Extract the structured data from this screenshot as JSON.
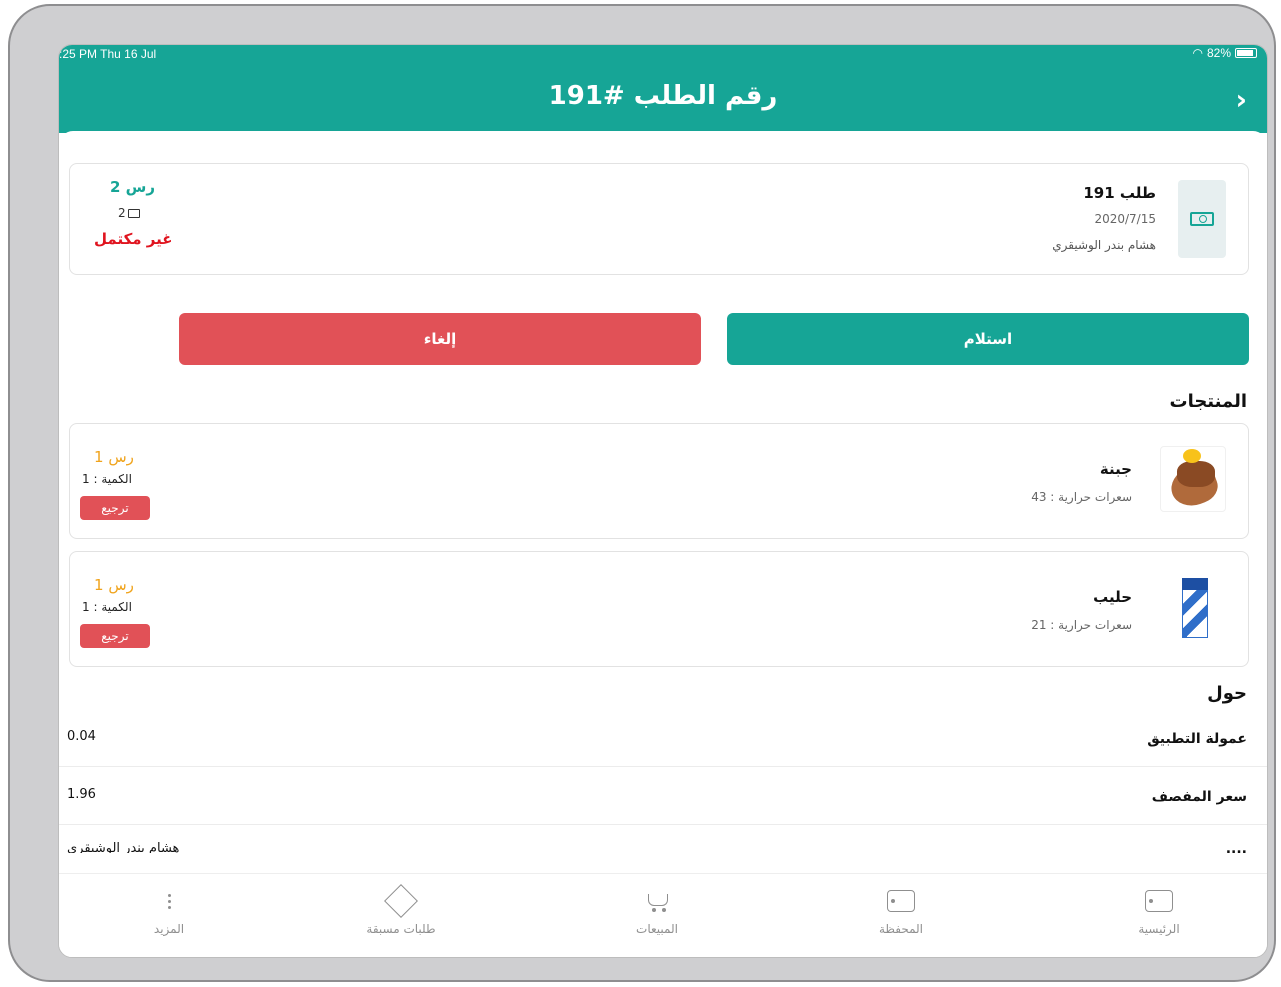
{
  "status_bar": {
    "time": ":25 PM  Thu 16 Jul",
    "battery": "82%"
  },
  "header": {
    "title": "رقم الطلب #191",
    "back_icon": "chevron-right-icon"
  },
  "order": {
    "title": "طلب 191",
    "date": "2020/7/15",
    "user": "هشام بندر الوشيقري",
    "price": "2 رس",
    "items_count": "2",
    "status": "غير مكتمل",
    "icon": "money-icon"
  },
  "actions": {
    "accept_label": "استلام",
    "cancel_label": "إلغاء"
  },
  "products_section": {
    "title": "المنتجات"
  },
  "products": [
    {
      "name": "جبنة",
      "calories": "سعرات حرارية : 43",
      "price": "1 رس",
      "qty": "الكمية : 1",
      "return_label": "ترجيع"
    },
    {
      "name": "حليب",
      "calories": "سعرات حرارية : 21",
      "price": "1 رس",
      "qty": "الكمية : 1",
      "return_label": "ترجيع"
    }
  ],
  "about_section": {
    "title": "حول",
    "rows": [
      {
        "label": "عمولة التطبيق",
        "value": "0.04"
      },
      {
        "label": "سعر المفصف",
        "value": "1.96"
      },
      {
        "label": "....",
        "value": "هشام بندر الوشيقري"
      }
    ]
  },
  "tabs": [
    {
      "label": "الرئيسية",
      "icon": "home-icon"
    },
    {
      "label": "المحفظة",
      "icon": "wallet-icon"
    },
    {
      "label": "المبيعات",
      "icon": "cart-icon"
    },
    {
      "label": "طلبات مسبقة",
      "icon": "box-icon"
    },
    {
      "label": "المزيد",
      "icon": "more-icon"
    }
  ],
  "colors": {
    "primary": "#16a596",
    "danger": "#e15157",
    "price_accent": "#f0a31b",
    "status_red": "#e0141f"
  }
}
